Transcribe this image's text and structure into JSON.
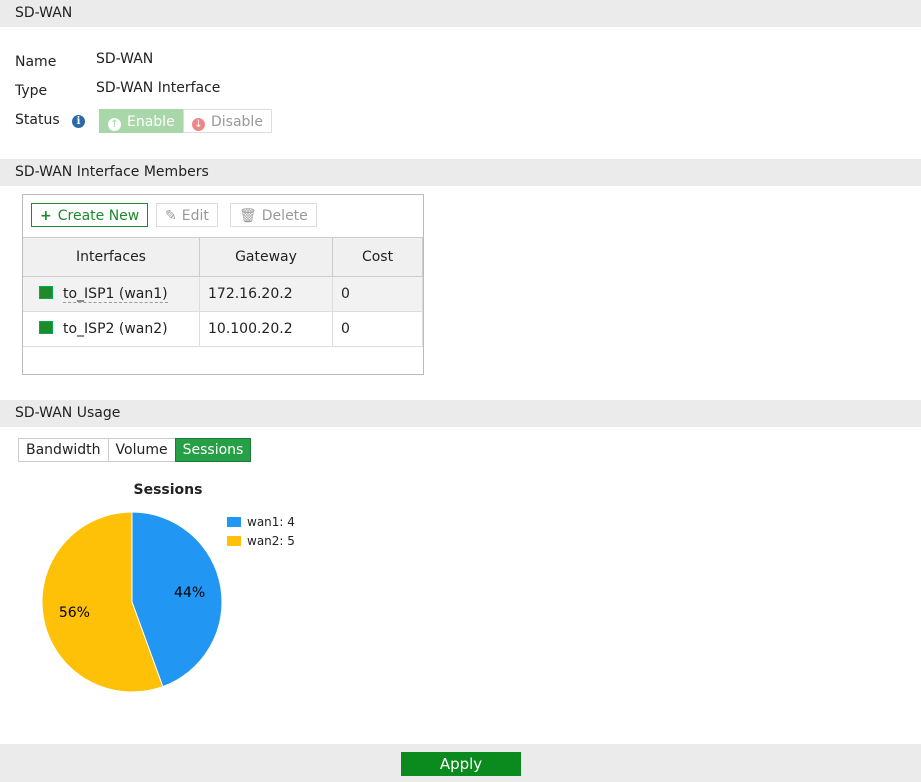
{
  "header": {
    "title": "SD-WAN"
  },
  "form": {
    "name_label": "Name",
    "name_value": "SD-WAN",
    "type_label": "Type",
    "type_value": "SD-WAN Interface",
    "status_label": "Status",
    "enable": "Enable",
    "disable": "Disable"
  },
  "members": {
    "title": "SD-WAN Interface Members",
    "create": "Create New",
    "edit": "Edit",
    "delete": "Delete",
    "columns": [
      "Interfaces",
      "Gateway",
      "Cost"
    ],
    "rows": [
      {
        "iface": "to_ISP1 (wan1)",
        "gw": "172.16.20.2",
        "cost": "0"
      },
      {
        "iface": "to_ISP2 (wan2)",
        "gw": "10.100.20.2",
        "cost": "0"
      }
    ]
  },
  "usage": {
    "title": "SD-WAN Usage",
    "tabs": [
      "Bandwidth",
      "Volume",
      "Sessions"
    ],
    "active_tab": "Sessions"
  },
  "chart_data": {
    "type": "pie",
    "title": "Sessions",
    "categories": [
      "wan1",
      "wan2"
    ],
    "values": [
      4,
      5
    ],
    "labels": [
      "44%",
      "56%"
    ],
    "legend": [
      "wan1: 4",
      "wan2: 5"
    ],
    "colors": [
      "#2196f3",
      "#ffc107"
    ],
    "legend_position": "right"
  },
  "footer": {
    "apply": "Apply"
  }
}
